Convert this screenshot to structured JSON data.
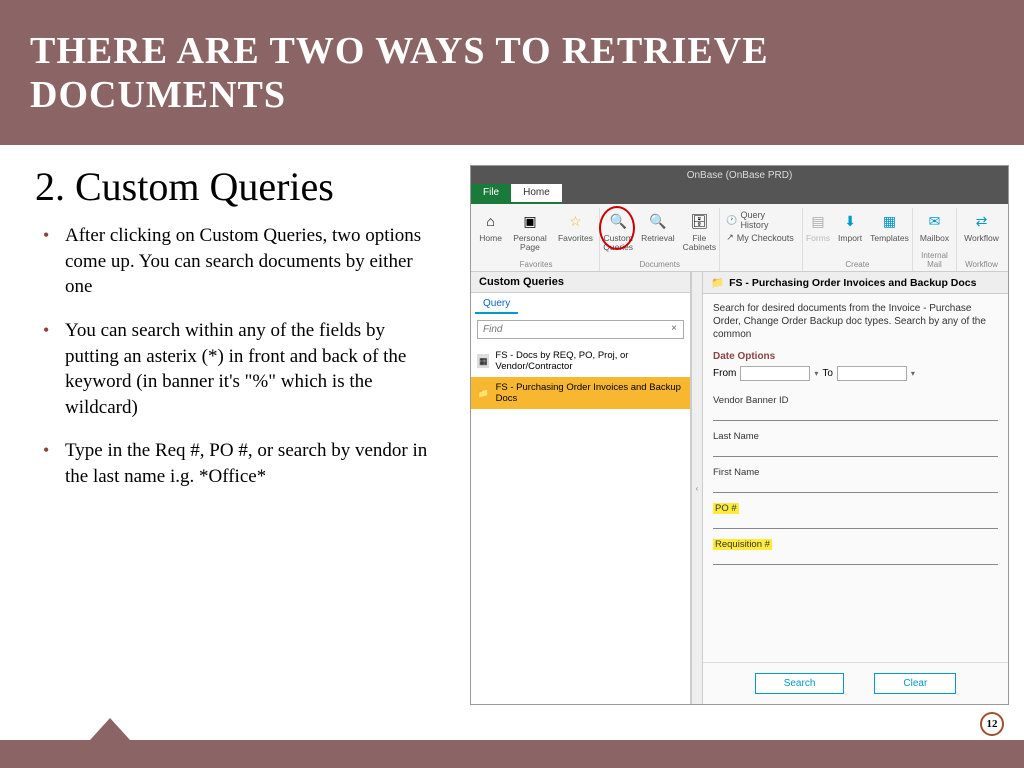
{
  "header": {
    "title": "THERE ARE TWO WAYS TO RETRIEVE DOCUMENTS"
  },
  "left": {
    "subtitle": "2. Custom Queries",
    "bullets": [
      "After clicking on Custom Queries, two options come up. You can search documents by either one",
      "You can search within any of the fields by putting an asterix (*) in front and back of the keyword (in banner it's \"%\" which is the wildcard)",
      "Type in the Req #, PO #, or search by vendor in the last name i.g. *Office*"
    ]
  },
  "app": {
    "title": "OnBase (OnBase PRD)",
    "tabs": {
      "file": "File",
      "home": "Home"
    },
    "ribbon": {
      "home": "Home",
      "personal": "Personal Page",
      "favorites": "Favorites",
      "custom": "Custom Queries",
      "retrieval": "Retrieval",
      "filecab": "File Cabinets",
      "queryhist": "Query History",
      "checkouts": "My Checkouts",
      "forms": "Forms",
      "import": "Import",
      "templates": "Templates",
      "mailbox": "Mailbox",
      "workflow": "Workflow",
      "g_fav": "Favorites",
      "g_doc": "Documents",
      "g_create": "Create",
      "g_mail": "Internal Mail",
      "g_wf": "Workflow"
    },
    "sidebar": {
      "title": "Custom Queries",
      "tab": "Query",
      "find_placeholder": "Find",
      "items": [
        "FS - Docs by REQ, PO, Proj, or Vendor/Contractor",
        "FS - Purchasing Order Invoices and Backup Docs"
      ]
    },
    "main": {
      "title": "FS - Purchasing Order Invoices and Backup Docs",
      "desc": "Search for desired documents from the Invoice - Purchase Order, Change Order Backup doc types.  Search by any of the common",
      "date_section": "Date Options",
      "from": "From",
      "to": "To",
      "fields": {
        "vendor": "Vendor Banner ID",
        "lastname": "Last Name",
        "firstname": "First Name",
        "po": "PO #",
        "req": "Requisition #"
      },
      "search": "Search",
      "clear": "Clear"
    }
  },
  "page": "12"
}
